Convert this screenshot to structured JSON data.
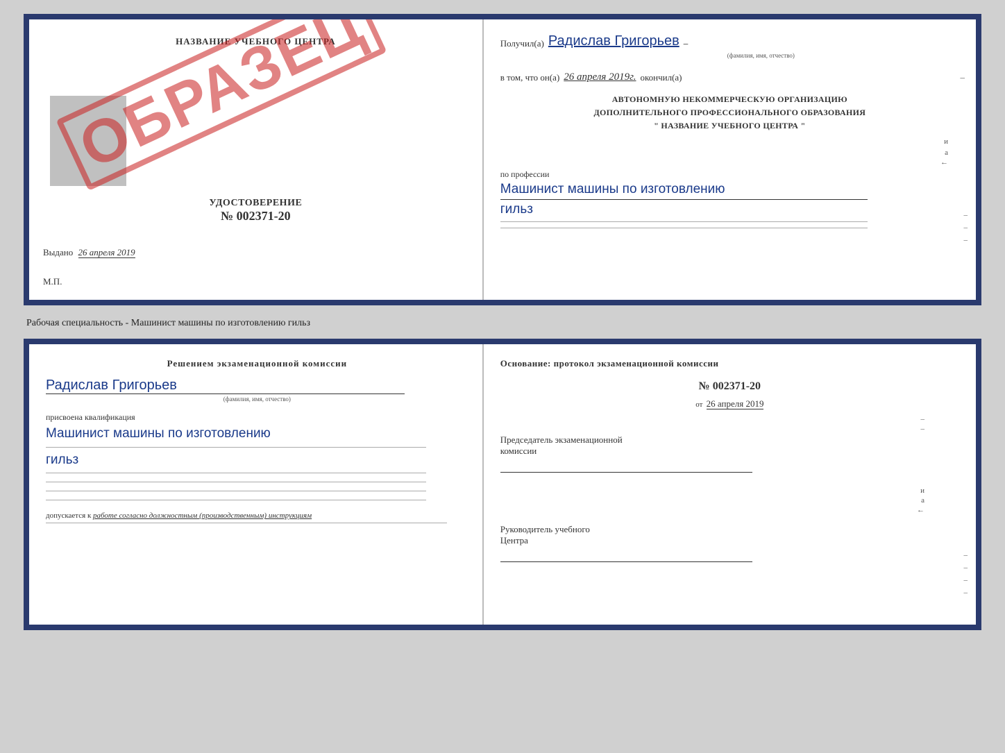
{
  "top_doc": {
    "left": {
      "center_title": "НАЗВАНИЕ УЧЕБНОГО ЦЕНТРА",
      "stamp_text": "ОБРАЗЕЦ",
      "udostoverenie_label": "УДОСТОВЕРЕНИЕ",
      "number": "№ 002371-20",
      "vydano_label": "Выдано",
      "vydano_date": "26 апреля 2019",
      "mp_label": "М.П."
    },
    "right": {
      "poluchil_label": "Получил(а)",
      "recipient_name": "Радислав Григорьев",
      "famiya_label": "(фамилия, имя, отчество)",
      "dash": "–",
      "vtom_label": "в том, что он(а)",
      "date": "26 апреля 2019г.",
      "okoncil_label": "окончил(а)",
      "org_line1": "АВТОНОМНУЮ НЕКОММЕРЧЕСКУЮ ОРГАНИЗАЦИЮ",
      "org_line2": "ДОПОЛНИТЕЛЬНОГО ПРОФЕССИОНАЛЬНОГО ОБРАЗОВАНИЯ",
      "org_line3": "\"  НАЗВАНИЕ УЧЕБНОГО ЦЕНТРА  \"",
      "po_professii": "по профессии",
      "profession_line1": "Машинист машины по изготовлению",
      "profession_line2": "гильз"
    }
  },
  "middle_caption": "Рабочая специальность - Машинист машины по изготовлению гильз",
  "bottom_doc": {
    "left": {
      "resheniem_title": "Решением  экзаменационной  комиссии",
      "name": "Радислав Григорьев",
      "famiya_label": "(фамилия, имя, отчество)",
      "prisvoena": "присвоена квалификация",
      "qualification_line1": "Машинист машины по изготовлению",
      "qualification_line2": "гильз",
      "dopuskaetsya_label": "допускается к",
      "dopuskaetsya_text": "работе согласно должностным (производственным) инструкциям"
    },
    "right": {
      "osnov_title": "Основание:  протокол  экзаменационной  комиссии",
      "protocol_num": "№  002371-20",
      "ot_label": "от",
      "ot_date": "26 апреля 2019",
      "predsedatel_line1": "Председатель экзаменационной",
      "predsedatel_line2": "комиссии",
      "rukovoditel_line1": "Руководитель учебного",
      "rukovoditel_line2": "Центра"
    }
  }
}
